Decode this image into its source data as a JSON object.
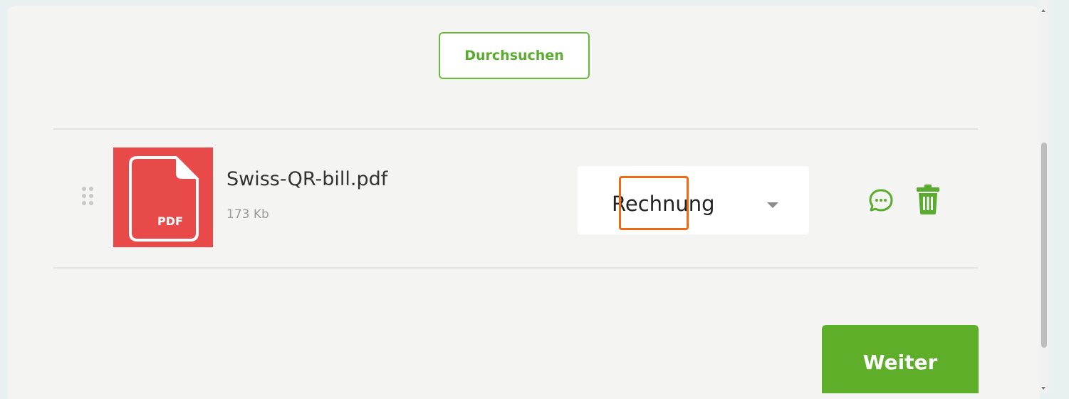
{
  "upload": {
    "browse_label": "Durchsuchen"
  },
  "file": {
    "name": "Swiss-QR-bill.pdf",
    "size": "173 Kb",
    "thumb_label": "PDF",
    "type_icon": "pdf-file-icon"
  },
  "document_type": {
    "selected": "Rechnung"
  },
  "actions": {
    "comment_icon": "comment-icon",
    "delete_icon": "trash-icon"
  },
  "footer": {
    "next_label": "Weiter"
  },
  "colors": {
    "accent_green": "#5fae2a",
    "pdf_red": "#e84a4a",
    "focus_orange": "#f06a14",
    "page_background": "#e9f0f1",
    "panel_background": "#f4f4f2"
  }
}
